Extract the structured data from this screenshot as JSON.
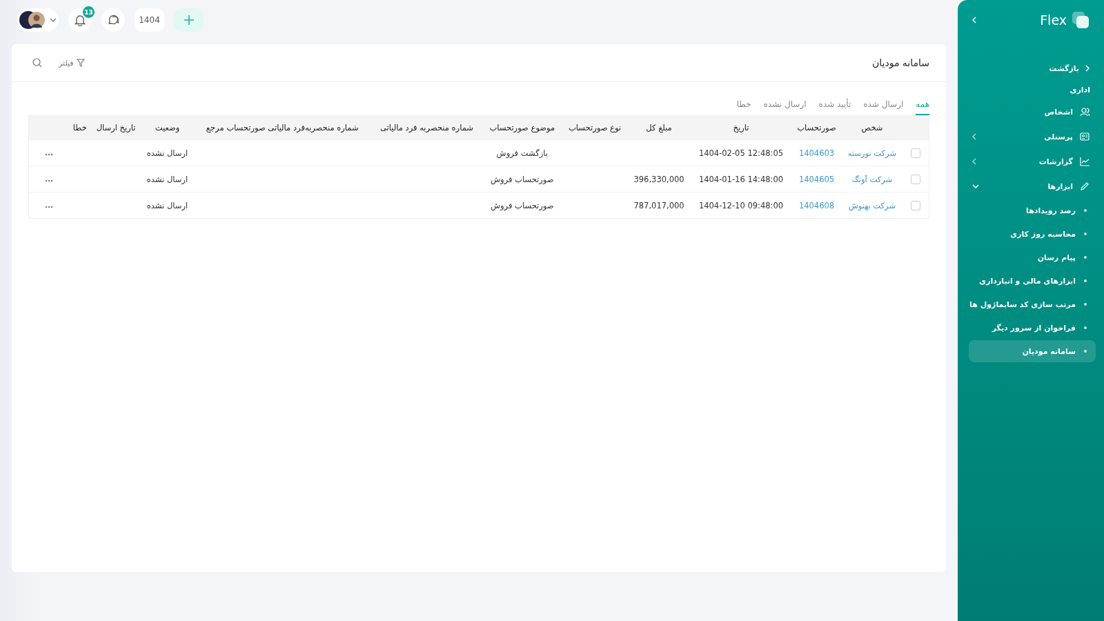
{
  "topbar": {
    "notifications_badge": "13",
    "year": "1404"
  },
  "sidebar": {
    "logo": "Flex",
    "back": "بازگشت",
    "section": "اداری",
    "items": [
      {
        "label": "اشخاص",
        "kind": "link"
      },
      {
        "label": "پرسنلی",
        "kind": "group",
        "expanded": false
      },
      {
        "label": "گزارشات",
        "kind": "group",
        "expanded": false
      },
      {
        "label": "ابزارها",
        "kind": "group",
        "expanded": true,
        "children": [
          {
            "label": "رصد رویدادها",
            "selected": false
          },
          {
            "label": "محاسبه روز کاری",
            "selected": false
          },
          {
            "label": "پیام رسان",
            "selected": false
          },
          {
            "label": "ابزارهای مالی و انبارداری",
            "selected": false
          },
          {
            "label": "مرتب سازی کد سابماژول ها",
            "selected": false
          },
          {
            "label": "فراخوان از سرور دیگر",
            "selected": false
          },
          {
            "label": "سامانه مودیان",
            "selected": true
          }
        ]
      }
    ]
  },
  "card": {
    "title": "سامانه مودیان",
    "filter": "فیلتر",
    "tabs": [
      {
        "label": "همه",
        "selected": true
      },
      {
        "label": "ارسال شده",
        "selected": false
      },
      {
        "label": "تأیید شده",
        "selected": false
      },
      {
        "label": "ارسال نشده",
        "selected": false
      },
      {
        "label": "خطا",
        "selected": false
      }
    ],
    "table": {
      "columns": [
        "شخص",
        "صورتحساب",
        "تاریخ",
        "مبلغ کل",
        "نوع صورتحساب",
        "موضوع صورتحساب",
        "شماره منحصربه فرد مالیاتی",
        "شماره منحصربه‌فرد مالیاتی صورتحساب مرجع",
        "وضعیت",
        "تاریخ ارسال",
        "خطا"
      ],
      "rows": [
        {
          "checked": false,
          "person": "شرکت نورسته",
          "invoice": "1404603",
          "date": "1404-02-05 12:48:05",
          "subject": "بازگشت فروش",
          "status": "ارسال نشده"
        },
        {
          "checked": false,
          "person": "شرکت آونگ",
          "invoice": "1404605",
          "date": "1404-01-16 14:48:00",
          "amount": "396,330,000",
          "subject": "صورتحساب فروش",
          "status": "ارسال نشده"
        },
        {
          "checked": false,
          "person": "شرکت بهنوش",
          "invoice": "1404608",
          "date": "1404-12-10 09:48:00",
          "amount": "787,017,000",
          "subject": "صورتحساب فروش",
          "status": "ارسال نشده"
        }
      ]
    }
  }
}
